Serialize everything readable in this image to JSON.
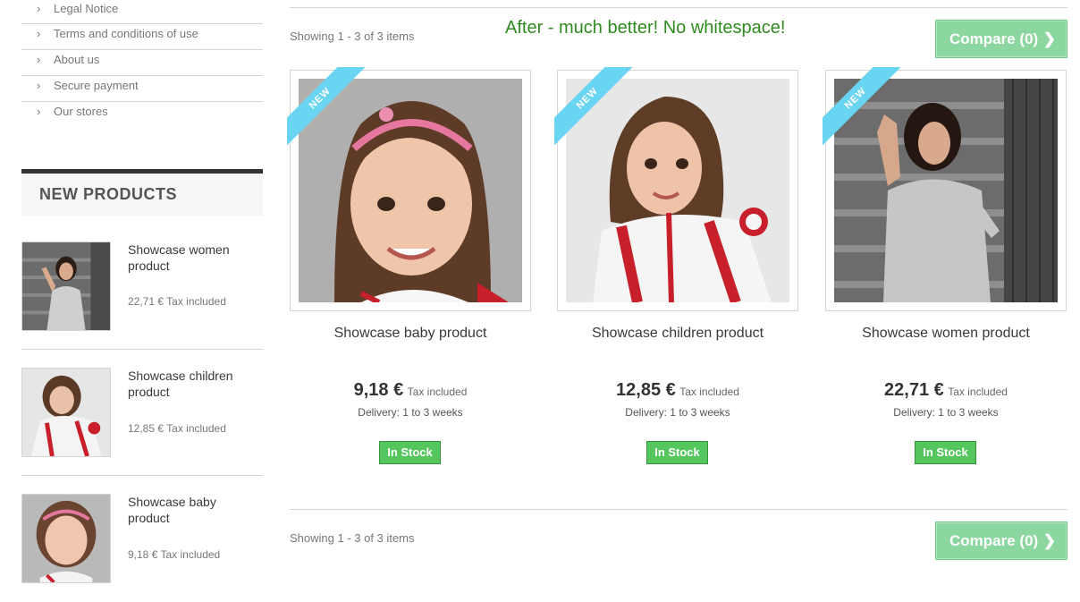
{
  "sidebar": {
    "info_links": [
      {
        "label": "Legal Notice"
      },
      {
        "label": "Terms and conditions of use"
      },
      {
        "label": "About us"
      },
      {
        "label": "Secure payment"
      },
      {
        "label": "Our stores"
      }
    ],
    "new_products_title": "NEW PRODUCTS",
    "new_products": [
      {
        "name": "Showcase women product",
        "price": "22,71 €",
        "tax": "Tax included"
      },
      {
        "name": "Showcase children product",
        "price": "12,85 €",
        "tax": "Tax included"
      },
      {
        "name": "Showcase baby product",
        "price": "9,18 €",
        "tax": "Tax included"
      }
    ]
  },
  "main": {
    "annotation": "After - much better! No whitespace!",
    "showing_top": "Showing 1 - 3 of 3 items",
    "showing_bottom": "Showing 1 - 3 of 3 items",
    "compare_label": "Compare (0)",
    "products": [
      {
        "badge": "NEW",
        "name": "Showcase baby product",
        "price": "9,18 €",
        "tax": "Tax included",
        "delivery": "Delivery: 1 to 3 weeks",
        "stock": "In Stock"
      },
      {
        "badge": "NEW",
        "name": "Showcase children product",
        "price": "12,85 €",
        "tax": "Tax included",
        "delivery": "Delivery: 1 to 3 weeks",
        "stock": "In Stock"
      },
      {
        "badge": "NEW",
        "name": "Showcase women product",
        "price": "22,71 €",
        "tax": "Tax included",
        "delivery": "Delivery: 1 to 3 weeks",
        "stock": "In Stock"
      }
    ]
  },
  "colors": {
    "ribbon": "#6ad4f3",
    "compare_button": "#8cd79f",
    "in_stock": "#55c65e",
    "annotation_text": "#2f8a1f",
    "sidebar_header_border": "#333333"
  },
  "icons": {
    "chevron": "chevron-right-icon"
  }
}
